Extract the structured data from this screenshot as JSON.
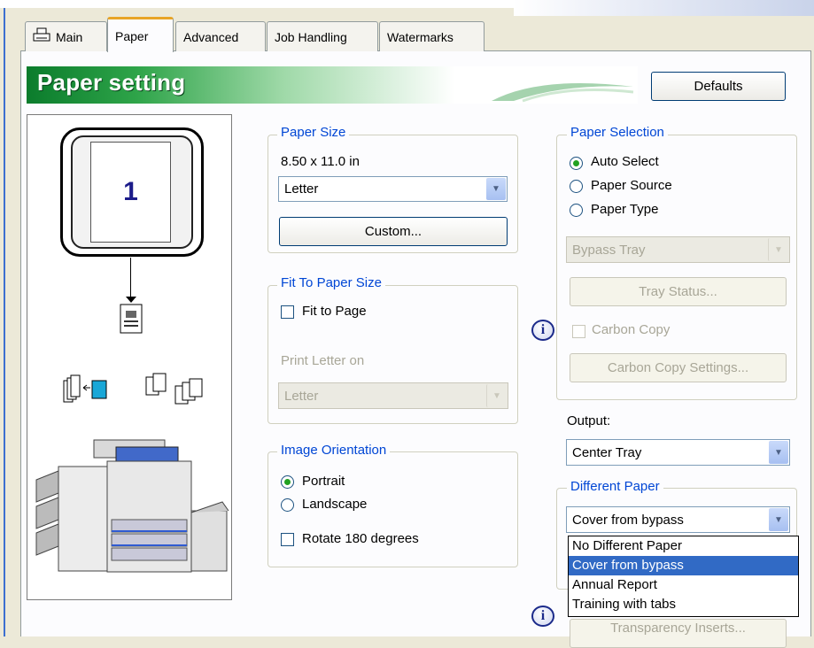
{
  "tabs": [
    {
      "label": "Main"
    },
    {
      "label": "Paper"
    },
    {
      "label": "Advanced"
    },
    {
      "label": "Job Handling"
    },
    {
      "label": "Watermarks"
    }
  ],
  "banner": {
    "title": "Paper setting"
  },
  "defaults_button": "Defaults",
  "preview": {
    "page_number": "1"
  },
  "paper_size": {
    "legend": "Paper Size",
    "dimensions": "8.50 x 11.0 in",
    "selected": "Letter",
    "custom_button": "Custom..."
  },
  "fit_to_paper": {
    "legend": "Fit To Paper Size",
    "fit_to_page_label": "Fit to Page",
    "fit_to_page_checked": false,
    "print_on_label": "Print Letter on",
    "print_on_value": "Letter"
  },
  "image_orientation": {
    "legend": "Image Orientation",
    "portrait_label": "Portrait",
    "landscape_label": "Landscape",
    "selected": "Portrait",
    "rotate_label": "Rotate 180 degrees",
    "rotate_checked": false
  },
  "paper_selection": {
    "legend": "Paper Selection",
    "options": [
      "Auto Select",
      "Paper Source",
      "Paper Type"
    ],
    "selected": "Auto Select",
    "tray_value": "Bypass Tray",
    "tray_status_button": "Tray Status...",
    "carbon_copy_label": "Carbon Copy",
    "carbon_copy_settings_button": "Carbon Copy Settings..."
  },
  "output": {
    "label": "Output:",
    "selected": "Center Tray"
  },
  "different_paper": {
    "legend": "Different Paper",
    "selected": "Cover from bypass",
    "options": [
      "No Different Paper",
      "Cover from bypass",
      "Annual Report",
      "Training with tabs"
    ],
    "highlighted_index": 1
  },
  "transparency_inserts_button": "Transparency Inserts...",
  "colors": {
    "accent_blue": "#0046d5",
    "banner_green": "#2ea449",
    "selection": "#316ac5",
    "tab_highlight": "#e8a426"
  },
  "icons": [
    "printer-icon",
    "info-icon",
    "paper-icon",
    "output-tray-icon",
    "multifunction-printer-icon"
  ]
}
